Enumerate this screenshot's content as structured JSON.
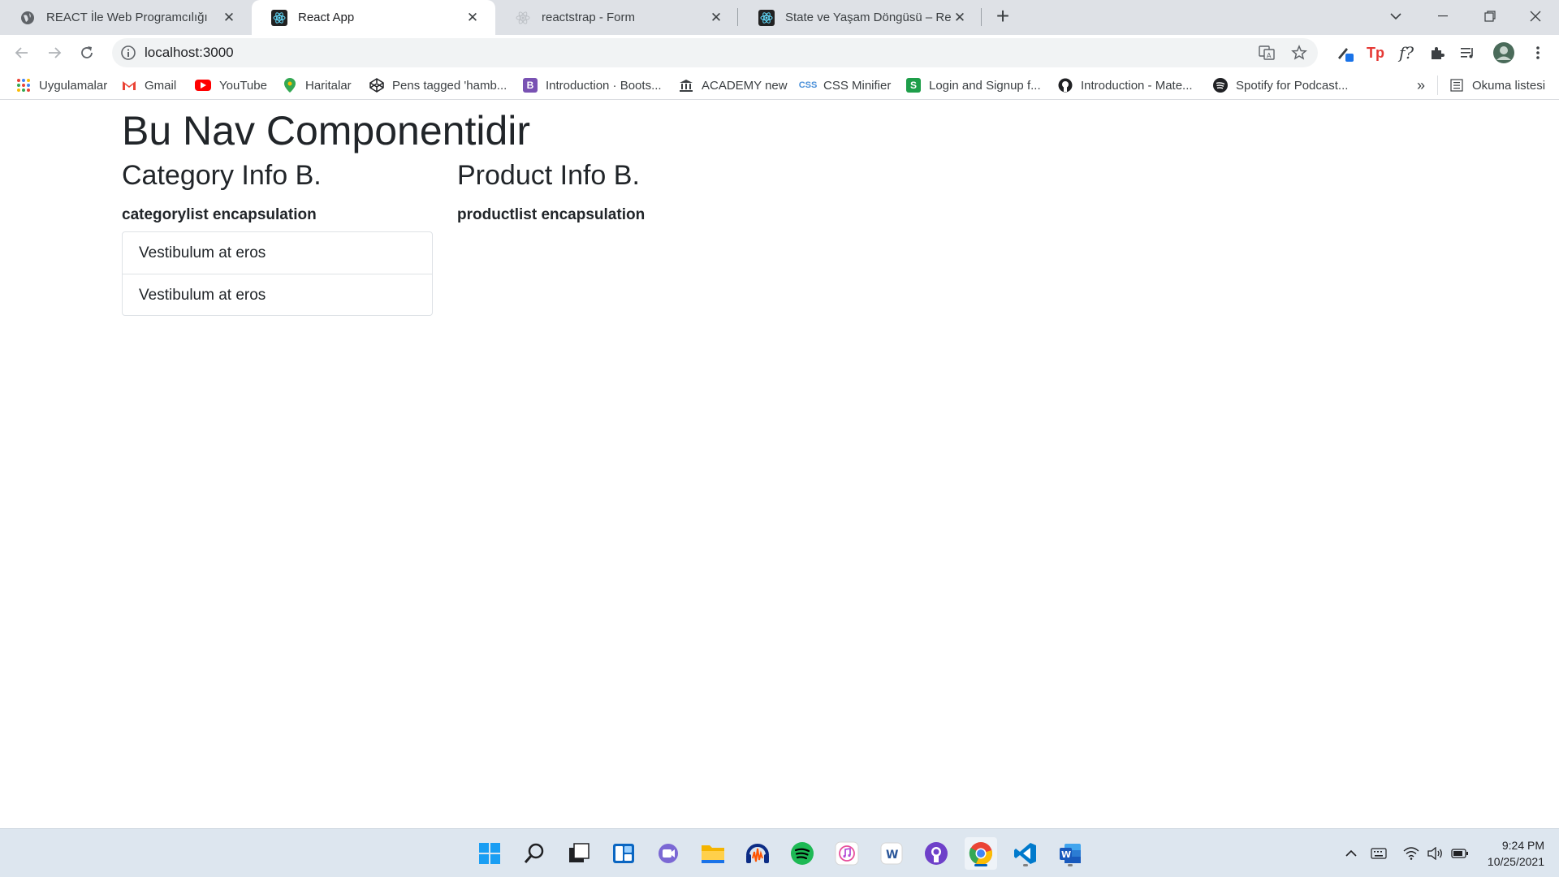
{
  "browser": {
    "tabs": [
      {
        "title": "REACT İle Web Programcılığı",
        "icon": "globe-icon"
      },
      {
        "title": "React App",
        "icon": "react-icon"
      },
      {
        "title": "reactstrap - Form",
        "icon": "react-icon"
      },
      {
        "title": "State ve Yaşam Döngüsü – React",
        "icon": "react-icon"
      }
    ],
    "url": "localhost:3000",
    "bookmarks": [
      {
        "label": "Uygulamalar",
        "icon": "apps-grid-icon"
      },
      {
        "label": "Gmail",
        "icon": "gmail-icon"
      },
      {
        "label": "YouTube",
        "icon": "youtube-icon"
      },
      {
        "label": "Haritalar",
        "icon": "maps-icon"
      },
      {
        "label": "Pens tagged 'hamb...",
        "icon": "codepen-icon"
      },
      {
        "label": "Introduction · Boots...",
        "icon": "bootstrap-icon"
      },
      {
        "label": "ACADEMY new",
        "icon": "academy-icon"
      },
      {
        "label": "CSS Minifier",
        "icon": "css-icon"
      },
      {
        "label": "Login and Signup f...",
        "icon": "s-icon"
      },
      {
        "label": "Introduction - Mate...",
        "icon": "github-icon"
      },
      {
        "label": "Spotify for Podcast...",
        "icon": "spotify-icon"
      }
    ],
    "reading_list": "Okuma listesi",
    "overflow": "»"
  },
  "page": {
    "nav_title": "Bu Nav Componentidir",
    "category": {
      "title": "Category Info B.",
      "subtitle": "categorylist encapsulation",
      "items": [
        "Vestibulum at eros",
        "Vestibulum at eros"
      ]
    },
    "product": {
      "title": "Product Info B.",
      "subtitle": "productlist encapsulation"
    }
  },
  "taskbar": {
    "time": "9:24 PM",
    "date": "10/25/2021"
  },
  "colors": {
    "accent": "#1a73e8",
    "text": "#212529",
    "border": "#dee2e6"
  }
}
